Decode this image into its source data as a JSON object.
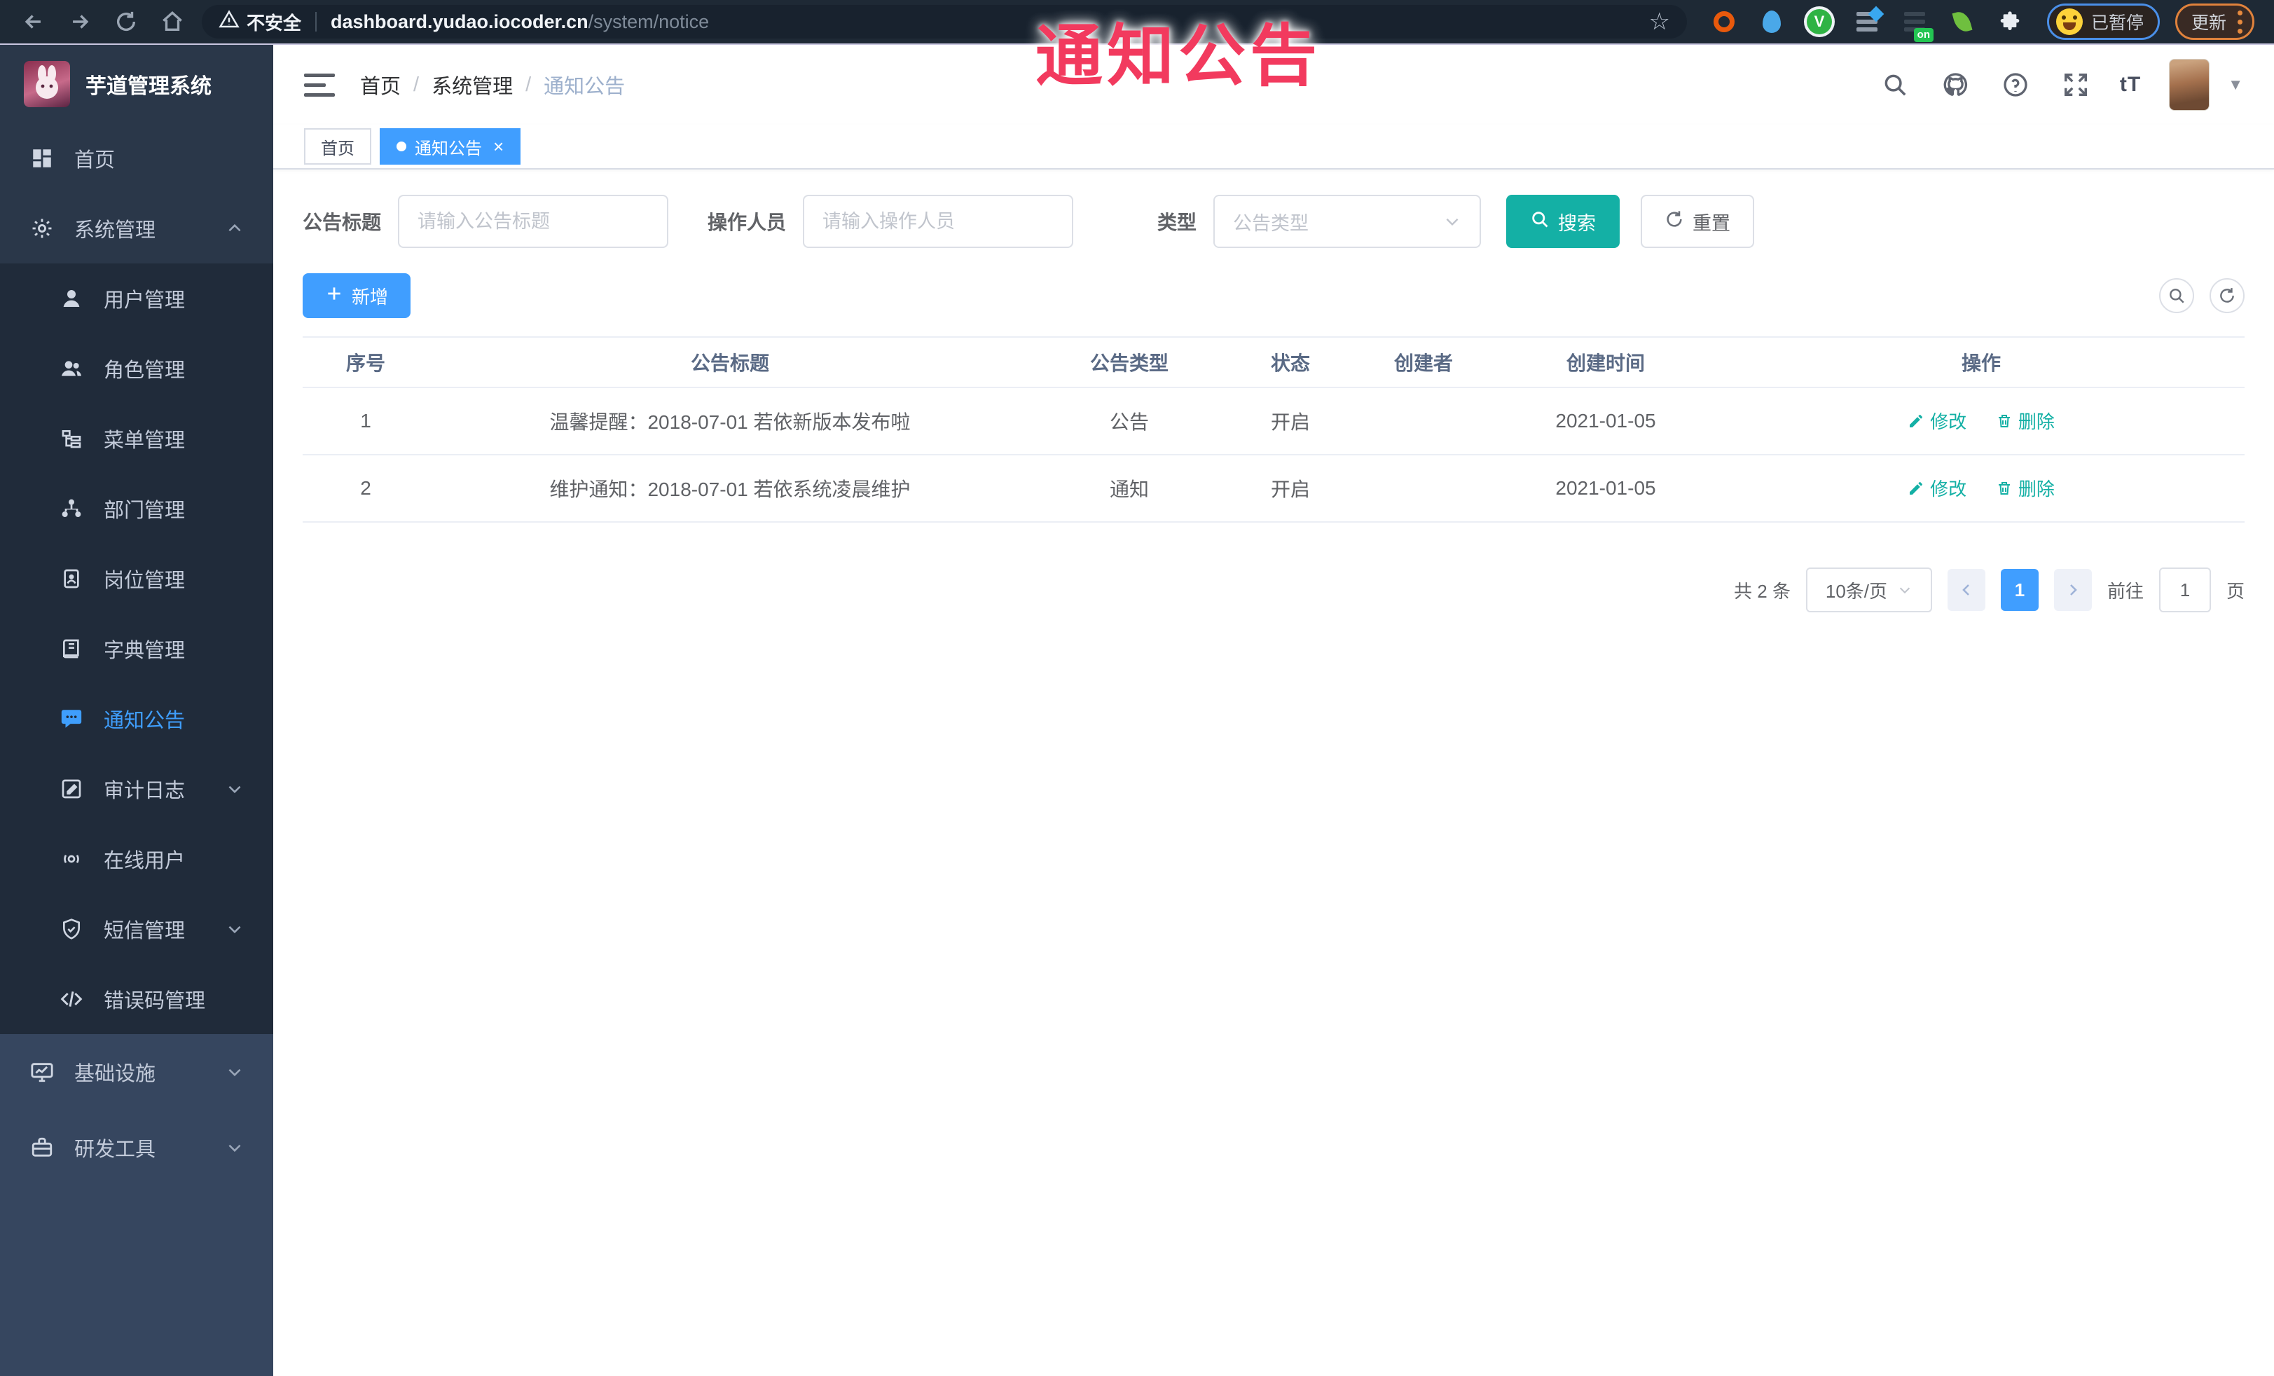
{
  "overlay": {
    "title": "通知公告"
  },
  "browser": {
    "security_label": "不安全",
    "url_host": "dashboard.yudao.iocoder.cn",
    "url_path": "/system/notice",
    "paused_badge": "已暂停",
    "update_label": "更新",
    "on_badge": "on"
  },
  "sidebar": {
    "app_title": "芋道管理系统",
    "items": [
      {
        "label": "首页"
      },
      {
        "label": "系统管理"
      },
      {
        "label": "用户管理"
      },
      {
        "label": "角色管理"
      },
      {
        "label": "菜单管理"
      },
      {
        "label": "部门管理"
      },
      {
        "label": "岗位管理"
      },
      {
        "label": "字典管理"
      },
      {
        "label": "通知公告"
      },
      {
        "label": "审计日志"
      },
      {
        "label": "在线用户"
      },
      {
        "label": "短信管理"
      },
      {
        "label": "错误码管理"
      },
      {
        "label": "基础设施"
      },
      {
        "label": "研发工具"
      }
    ]
  },
  "header": {
    "text_size_label": "tT"
  },
  "breadcrumb": {
    "items": [
      "首页",
      "系统管理",
      "通知公告"
    ],
    "separator": "/"
  },
  "tabs": {
    "items": [
      {
        "label": "首页"
      },
      {
        "label": "通知公告"
      }
    ],
    "close_glyph": "×"
  },
  "filters": {
    "title_label": "公告标题",
    "title_placeholder": "请输入公告标题",
    "operator_label": "操作人员",
    "operator_placeholder": "请输入操作人员",
    "type_label": "类型",
    "type_placeholder": "公告类型",
    "search_label": "搜索",
    "reset_label": "重置"
  },
  "toolbar": {
    "add_label": "新增"
  },
  "table": {
    "columns": [
      "序号",
      "公告标题",
      "公告类型",
      "状态",
      "创建者",
      "创建时间",
      "操作"
    ],
    "rows": [
      {
        "no": "1",
        "title": "温馨提醒：2018-07-01 若依新版本发布啦",
        "type": "公告",
        "status": "开启",
        "creator": "",
        "created": "2021-01-05"
      },
      {
        "no": "2",
        "title": "维护通知：2018-07-01 若依系统凌晨维护",
        "type": "通知",
        "status": "开启",
        "creator": "",
        "created": "2021-01-05"
      }
    ],
    "edit_label": "修改",
    "delete_label": "删除"
  },
  "pagination": {
    "total": "共 2 条",
    "page_size": "10条/页",
    "current": "1",
    "goto_prefix": "前往",
    "goto_suffix": "页",
    "goto_value": "1"
  },
  "colors": {
    "accent": "#409eff",
    "teal": "#14b0a5",
    "overlay_red": "#f23a5e"
  }
}
